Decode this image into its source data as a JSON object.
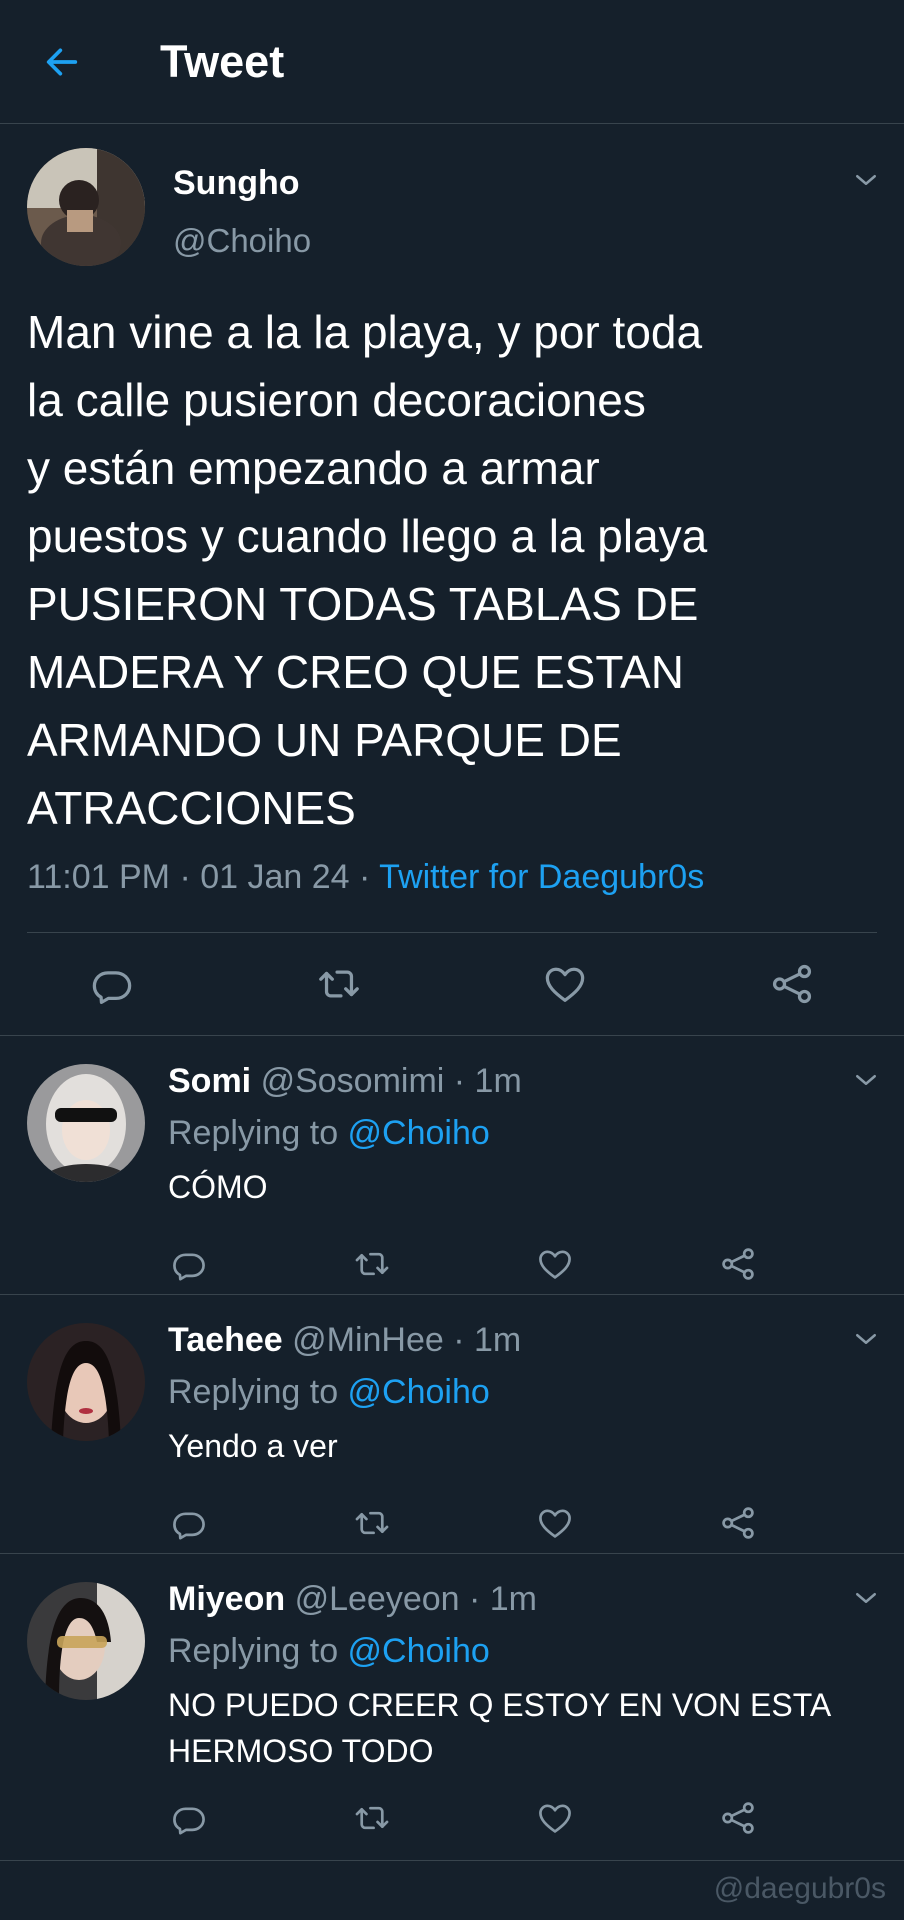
{
  "header": {
    "title": "Tweet",
    "back_icon": "arrow-left-icon",
    "accent": "#1da1f2"
  },
  "main_tweet": {
    "name": "Sungho",
    "handle": "@Choiho",
    "text": "Man vine a la la playa, y por toda\nla calle pusieron decoraciones\ny están empezando a armar\npuestos y cuando llego a la playa\nPUSIERON TODAS TABLAS DE\nMADERA Y CREO QUE ESTAN\nARMANDO UN PARQUE DE\nATRACCIONES",
    "time": "11:01 PM · 01 Jan 24 · ",
    "source": "Twitter for Daegubr0s",
    "actions": [
      "reply-icon",
      "retweet-icon",
      "like-icon",
      "share-icon"
    ]
  },
  "replies": [
    {
      "name": "Somi",
      "handle": "@Sosomimi · 1m",
      "replying_prefix": "Replying to ",
      "replying_to": "@Choiho",
      "text": "CÓMO"
    },
    {
      "name": "Taehee",
      "handle": "@MinHee · 1m",
      "replying_prefix": "Replying to ",
      "replying_to": "@Choiho",
      "text": "Yendo a ver"
    },
    {
      "name": "Miyeon",
      "handle": "@Leeyeon · 1m",
      "replying_prefix": "Replying to ",
      "replying_to": "@Choiho",
      "text": "NO PUEDO CREER Q ESTOY EN VON ESTA HERMOSO TODO"
    }
  ],
  "watermark": "@daegubr0s",
  "colors": {
    "background": "#15202b",
    "secondary_text": "#8899a6",
    "divider": "#38444d",
    "link": "#1da1f2"
  }
}
